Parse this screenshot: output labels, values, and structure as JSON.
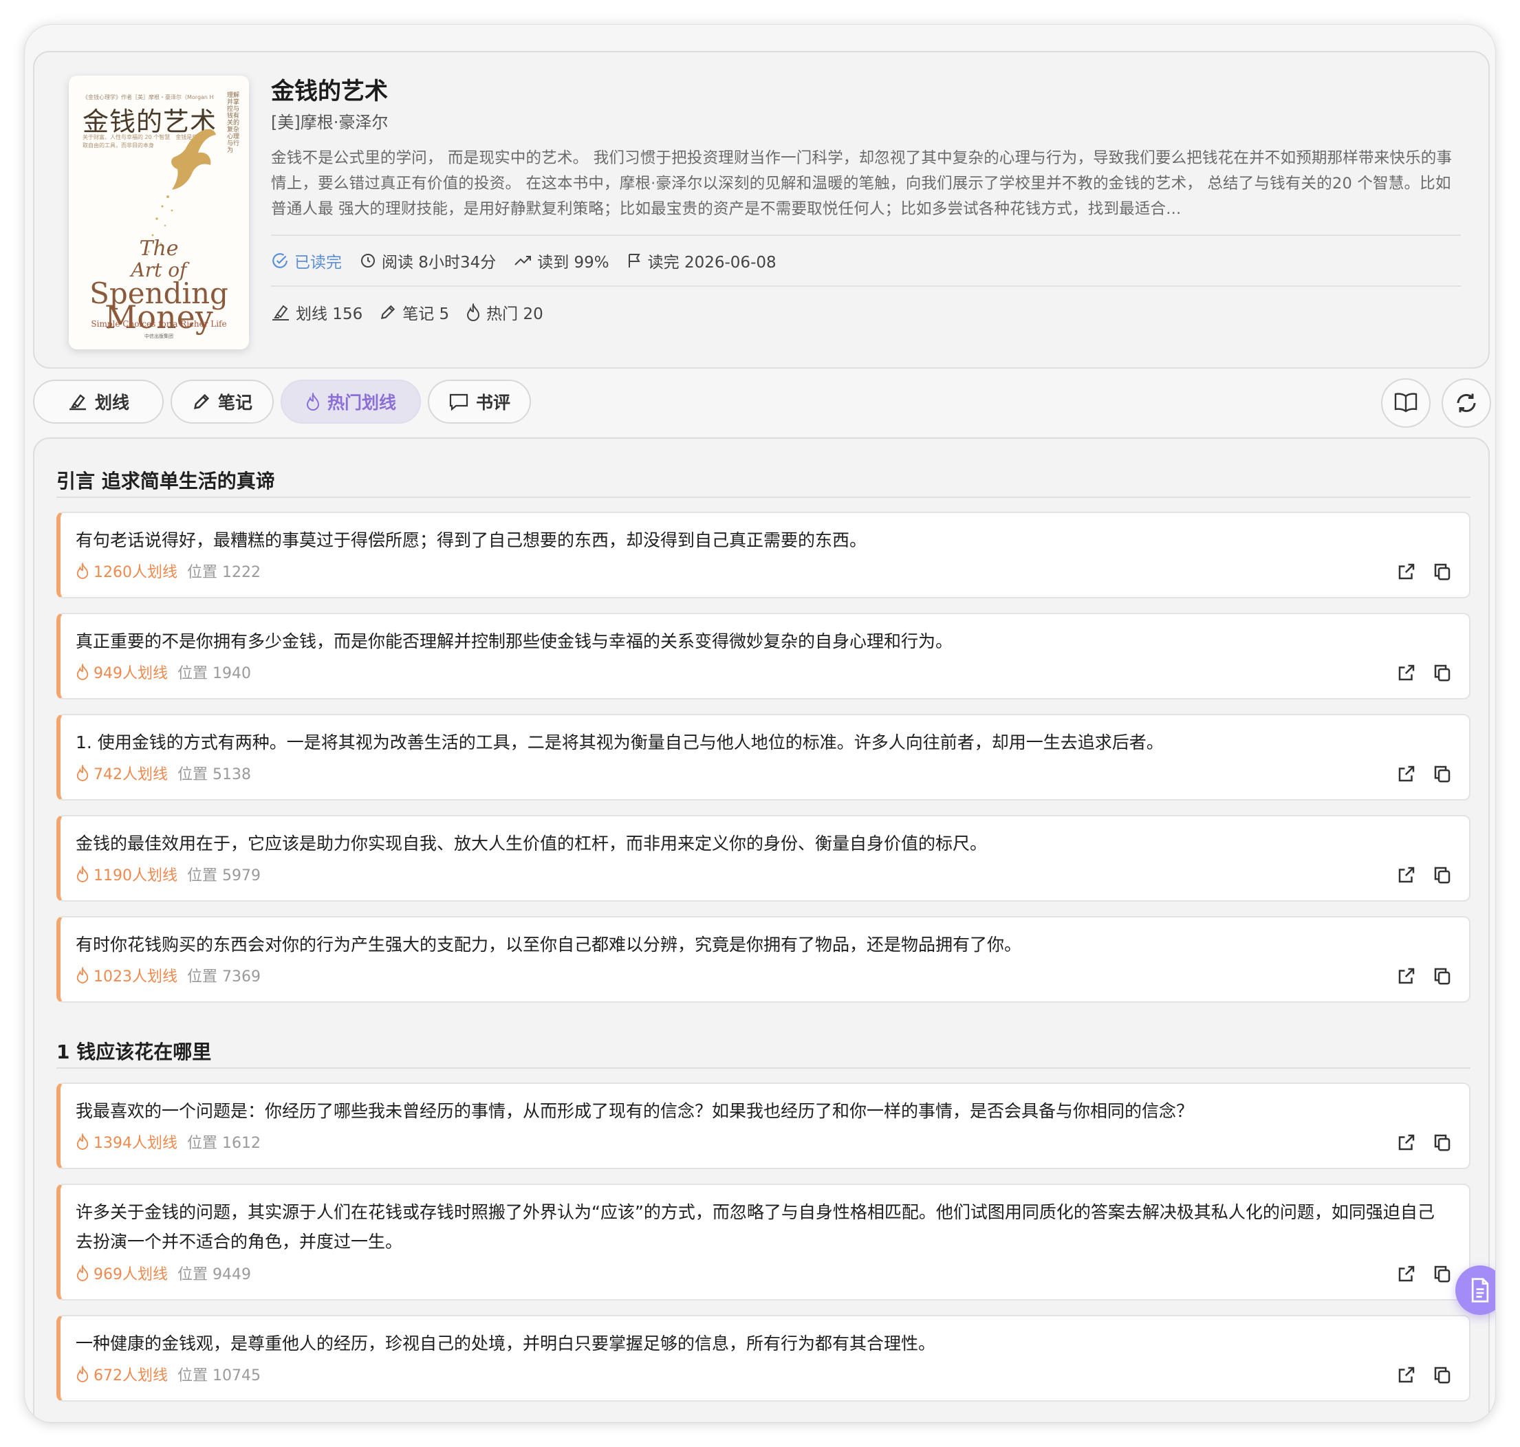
{
  "book": {
    "title": "金钱的艺术",
    "author": "[美]摩根·豪泽尔",
    "description": "金钱不是公式里的学问， 而是现实中的艺术。 我们习惯于把投资理财当作一门科学，却忽视了其中复杂的心理与行为，导致我们要么把钱花在并不如预期那样带来快乐的事情上，要么错过真正有价值的投资。 在这本书中，摩根·豪泽尔以深刻的见解和温暖的笔触，向我们展示了学校里并不教的金钱的艺术， 总结了与钱有关的20 个智慧。比如普通人最 强大的理财技能，是用好静默复利策略；比如最宝贵的资产是不需要取悦任何人；比如多尝试各种花钱方式，找到最适合...",
    "cover": {
      "top_line": "《金钱心理学》作者［美］摩根・豪泽尔（Morgan Housel）著 潘婕 译",
      "title": "金钱的艺术",
      "subtitle": "关于财富、人性与幸福的 20 个智慧　金钱是获取自由的工具，而非目的本身",
      "vertical": "理解并掌控与钱有关的复杂心理与行为",
      "en_the": "The",
      "en_art": "Art of",
      "en_spending": "Spending",
      "en_money": "Money",
      "en_tagline": "Simple Choices for a Richer Life",
      "publisher": "中信出版集团"
    }
  },
  "status": {
    "read_state": "已读完",
    "read_time": "阅读 8小时34分",
    "progress": "读到 99%",
    "finished": "读完 2026-06-08"
  },
  "counts": {
    "highlights": "划线 156",
    "notes": "笔记 5",
    "popular": "热门 20"
  },
  "tabs": [
    {
      "label": "划线"
    },
    {
      "label": "笔记"
    },
    {
      "label": "热门划线"
    },
    {
      "label": "书评"
    }
  ],
  "sections": [
    {
      "title": "引言 追求简单生活的真谛",
      "items": [
        {
          "text": "有句老话说得好，最糟糕的事莫过于得偿所愿；得到了自己想要的东西，却没得到自己真正需要的东西。",
          "count": "1260人划线",
          "pos": "位置 1222"
        },
        {
          "text": "真正重要的不是你拥有多少金钱，而是你能否理解并控制那些使金钱与幸福的关系变得微妙复杂的自身心理和行为。",
          "count": "949人划线",
          "pos": "位置 1940"
        },
        {
          "text": "1. 使用金钱的方式有两种。一是将其视为改善生活的工具，二是将其视为衡量自己与他人地位的标准。许多人向往前者，却用一生去追求后者。",
          "count": "742人划线",
          "pos": "位置 5138"
        },
        {
          "text": "金钱的最佳效用在于，它应该是助力你实现自我、放大人生价值的杠杆，而非用来定义你的身份、衡量自身价值的标尺。",
          "count": "1190人划线",
          "pos": "位置 5979"
        },
        {
          "text": "有时你花钱购买的东西会对你的行为产生强大的支配力，以至你自己都难以分辨，究竟是你拥有了物品，还是物品拥有了你。",
          "count": "1023人划线",
          "pos": "位置 7369"
        }
      ]
    },
    {
      "title": "1 钱应该花在哪里",
      "items": [
        {
          "text": "我最喜欢的一个问题是：你经历了哪些我未曾经历的事情，从而形成了现有的信念？如果我也经历了和你一样的事情，是否会具备与你相同的信念？",
          "count": "1394人划线",
          "pos": "位置 1612"
        },
        {
          "text": "许多关于金钱的问题，其实源于人们在花钱或存钱时照搬了外界认为“应该”的方式，而忽略了与自身性格相匹配。他们试图用同质化的答案去解决极其私人化的问题，如同强迫自己去扮演一个并不适合的角色，并度过一生。",
          "count": "969人划线",
          "pos": "位置 9449"
        },
        {
          "text": "一种健康的金钱观，是尊重他人的经历，珍视自己的处境，并明白只要掌握足够的信息，所有行为都有其合理性。",
          "count": "672人划线",
          "pos": "位置 10745"
        }
      ]
    }
  ],
  "colors": {
    "accent": "#8b6fd6",
    "highlight_bar": "#f2a66e",
    "count": "#ec8a4f",
    "done": "#5b8fd8",
    "fab": "#a38cf5"
  },
  "icons": [
    "highlighter-icon",
    "pencil-icon",
    "flame-icon",
    "comment-icon",
    "book-open-icon",
    "refresh-icon",
    "check-circle-icon",
    "clock-icon",
    "trend-up-icon",
    "flag-icon",
    "external-link-icon",
    "copy-icon",
    "document-icon"
  ]
}
